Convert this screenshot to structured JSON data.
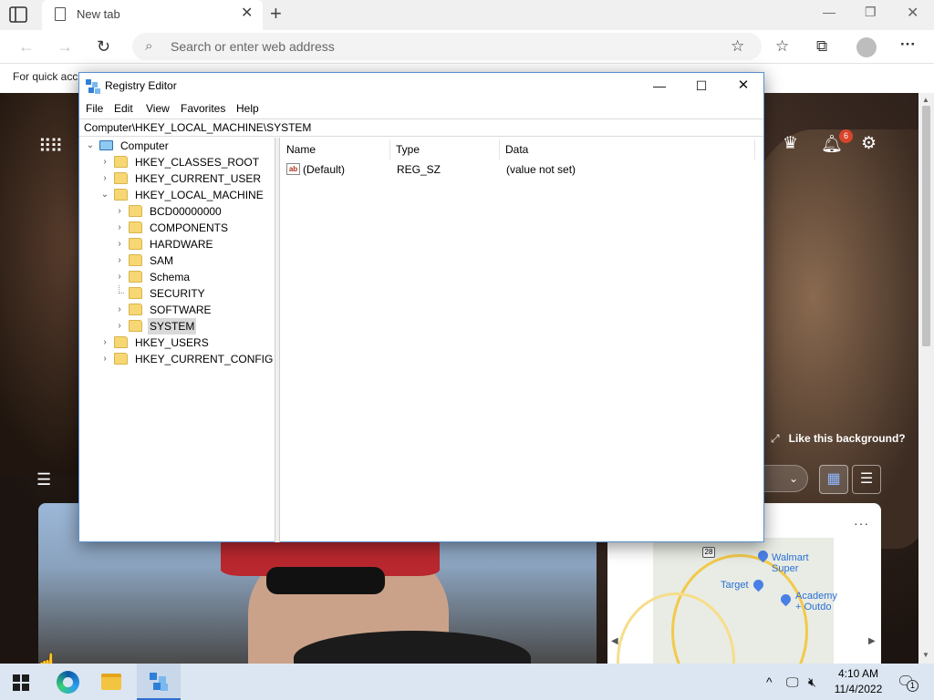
{
  "browser": {
    "tab_title": "New tab",
    "address_placeholder": "Search or enter web address",
    "favorites_bar_text": "For quick acc"
  },
  "ntp": {
    "notification_count": "6",
    "like_background": "Like this background?"
  },
  "regedit": {
    "title": "Registry Editor",
    "menu": [
      "File",
      "Edit",
      "View",
      "Favorites",
      "Help"
    ],
    "path": "Computer\\HKEY_LOCAL_MACHINE\\SYSTEM",
    "tree": {
      "root": "Computer",
      "hives": [
        "HKEY_CLASSES_ROOT",
        "HKEY_CURRENT_USER",
        "HKEY_LOCAL_MACHINE",
        "HKEY_USERS",
        "HKEY_CURRENT_CONFIG"
      ],
      "hklm_children": [
        "BCD00000000",
        "COMPONENTS",
        "HARDWARE",
        "SAM",
        "Schema",
        "SECURITY",
        "SOFTWARE",
        "SYSTEM"
      ],
      "selected": "SYSTEM"
    },
    "columns": [
      "Name",
      "Type",
      "Data"
    ],
    "values": [
      {
        "name": "(Default)",
        "type": "REG_SZ",
        "data": "(value not set)",
        "icon": "string-value-icon"
      }
    ]
  },
  "map": {
    "labels": [
      "Walmart Super",
      "Target",
      "Academy",
      "+ Outdo"
    ],
    "highway": "28"
  },
  "taskbar": {
    "time": "4:10 AM",
    "date": "11/4/2022",
    "notification_count": "1"
  },
  "colors": {
    "accent": "#2e6fd1",
    "folder": "#f7d774",
    "badge": "#d9452b"
  }
}
